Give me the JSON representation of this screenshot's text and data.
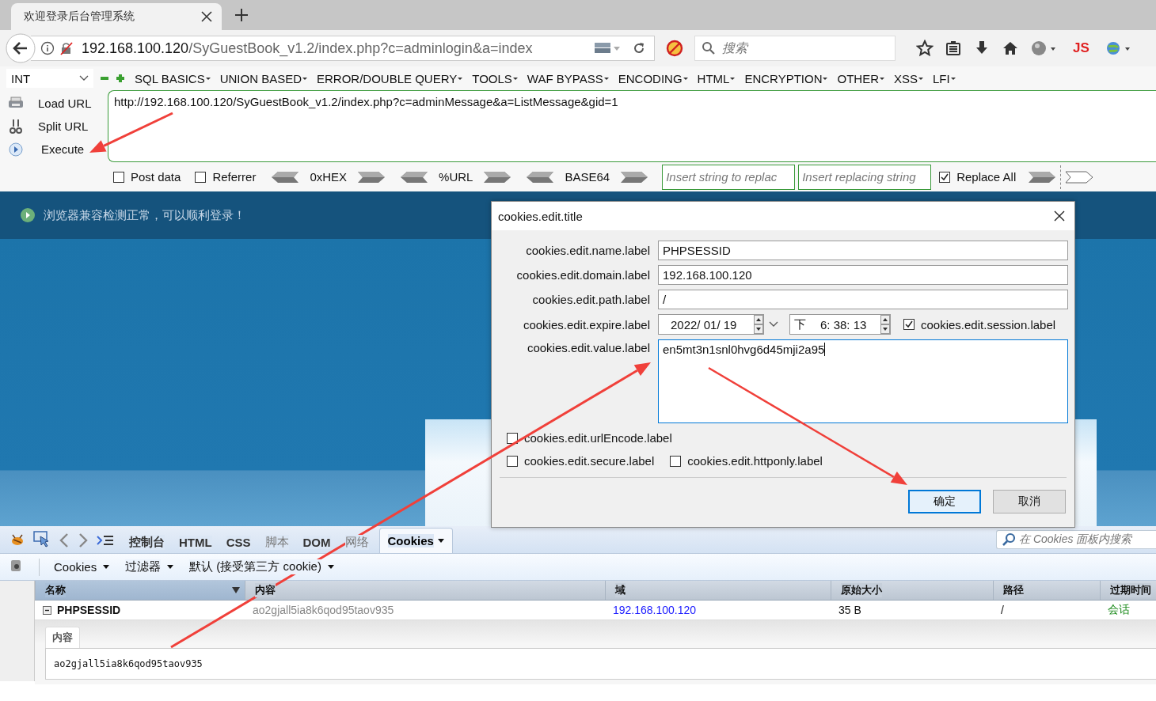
{
  "browser_tab": {
    "title": "欢迎登录后台管理系统"
  },
  "address_bar": {
    "host": "192.168.100.120",
    "path": "/SyGuestBook_v1.2/index.php?c=adminlogin&a=index"
  },
  "search": {
    "placeholder": "搜索"
  },
  "toolbar": {
    "js_label": "JS"
  },
  "hackbar": {
    "select": "INT",
    "menus": [
      "SQL BASICS",
      "UNION BASED",
      "ERROR/DOUBLE QUERY",
      "TOOLS",
      "WAF BYPASS",
      "ENCODING",
      "HTML",
      "ENCRYPTION",
      "OTHER",
      "XSS",
      "LFI"
    ],
    "actions": [
      {
        "label": "Load URL",
        "kind": "load"
      },
      {
        "label": "Split URL",
        "kind": "split"
      },
      {
        "label": "Execute",
        "kind": "execute"
      }
    ],
    "url": "http://192.168.100.120/SyGuestBook_v1.2/index.php?c=adminMessage&a=ListMessage&gid=1",
    "options": [
      {
        "label": "Post data",
        "checked": false
      },
      {
        "label": "Referrer",
        "checked": false
      }
    ],
    "encoders": [
      "0xHEX",
      "%URL",
      "BASE64"
    ],
    "replace_from": {
      "placeholder": "Insert string to replac"
    },
    "replace_to": {
      "placeholder": "Insert replacing string"
    },
    "replace_all": {
      "label": "Replace All",
      "checked": true
    }
  },
  "page": {
    "notice": "浏览器兼容检测正常，可以顺利登录！"
  },
  "dialog": {
    "title": "cookies.edit.title",
    "fields": [
      {
        "label": "cookies.edit.name.label",
        "value": "PHPSESSID"
      },
      {
        "label": "cookies.edit.domain.label",
        "value": "192.168.100.120"
      },
      {
        "label": "cookies.edit.path.label",
        "value": "/"
      }
    ],
    "expire": {
      "label": "cookies.edit.expire.label",
      "date": "2022/ 01/ 19",
      "ampm": "下",
      "time": "6: 38: 13"
    },
    "session": {
      "label": "cookies.edit.session.label",
      "checked": true
    },
    "value": {
      "label": "cookies.edit.value.label",
      "value": "en5mt3n1snl0hvg6d45mji2a95"
    },
    "url_encode": {
      "label": "cookies.edit.urlEncode.label",
      "checked": false
    },
    "flags": [
      {
        "label": "cookies.edit.secure.label",
        "checked": false
      },
      {
        "label": "cookies.edit.httponly.label",
        "checked": false
      }
    ],
    "buttons": [
      {
        "label": "确定",
        "default": true
      },
      {
        "label": "取消",
        "default": false
      }
    ]
  },
  "devtools": {
    "tabs": [
      {
        "label": "控制台",
        "selected": false,
        "disabled": false
      },
      {
        "label": "HTML",
        "selected": false,
        "disabled": false
      },
      {
        "label": "CSS",
        "selected": false,
        "disabled": false
      },
      {
        "label": "脚本",
        "selected": false,
        "disabled": true
      },
      {
        "label": "DOM",
        "selected": false,
        "disabled": false
      },
      {
        "label": "网络",
        "selected": false,
        "disabled": true
      },
      {
        "label": "Cookies",
        "selected": true,
        "disabled": false
      }
    ],
    "search": {
      "placeholder": "在 Cookies 面板内搜索"
    },
    "menus": [
      "Cookies",
      "过滤器",
      "默认 (接受第三方 cookie)"
    ],
    "columns": [
      "名称",
      "内容",
      "域",
      "原始大小",
      "路径",
      "过期时间"
    ],
    "rows": [
      {
        "name": "PHPSESSID",
        "expanded": true,
        "content": "ao2gjall5ia8k6qod95taov935",
        "domain": "192.168.100.120",
        "size": "35 B",
        "path": "/",
        "expires": "会话"
      }
    ],
    "detail": {
      "tab": "内容",
      "text": "ao2gjall5ia8k6qod95taov935"
    }
  }
}
